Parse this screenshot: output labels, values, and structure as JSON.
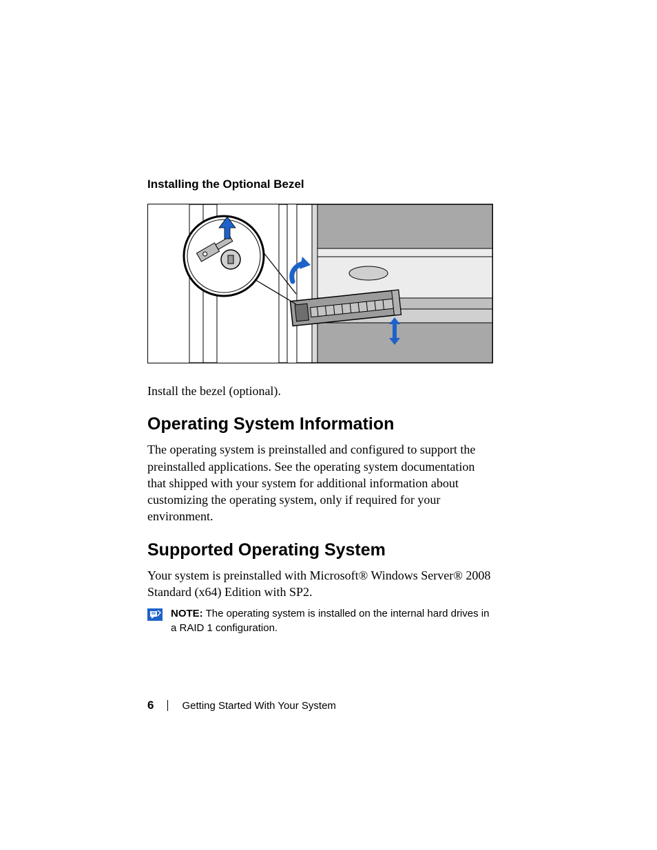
{
  "subhead": "Installing the Optional Bezel",
  "caption1": "Install the bezel (optional).",
  "heading1": "Operating System Information",
  "para1": "The operating system is preinstalled and configured to support the preinstalled applications. See the operating system documentation that shipped with your system for additional information about customizing the operating system, only if required for your environment.",
  "heading2": "Supported Operating System",
  "para2": "Your system is preinstalled with Microsoft® Windows Server® 2008 Standard (x64) Edition with SP2.",
  "note_label": "NOTE:",
  "note_text": " The operating system is installed on the internal hard drives in a RAID 1 configuration.",
  "footer": {
    "page_number": "6",
    "section": "Getting Started With Your System"
  }
}
